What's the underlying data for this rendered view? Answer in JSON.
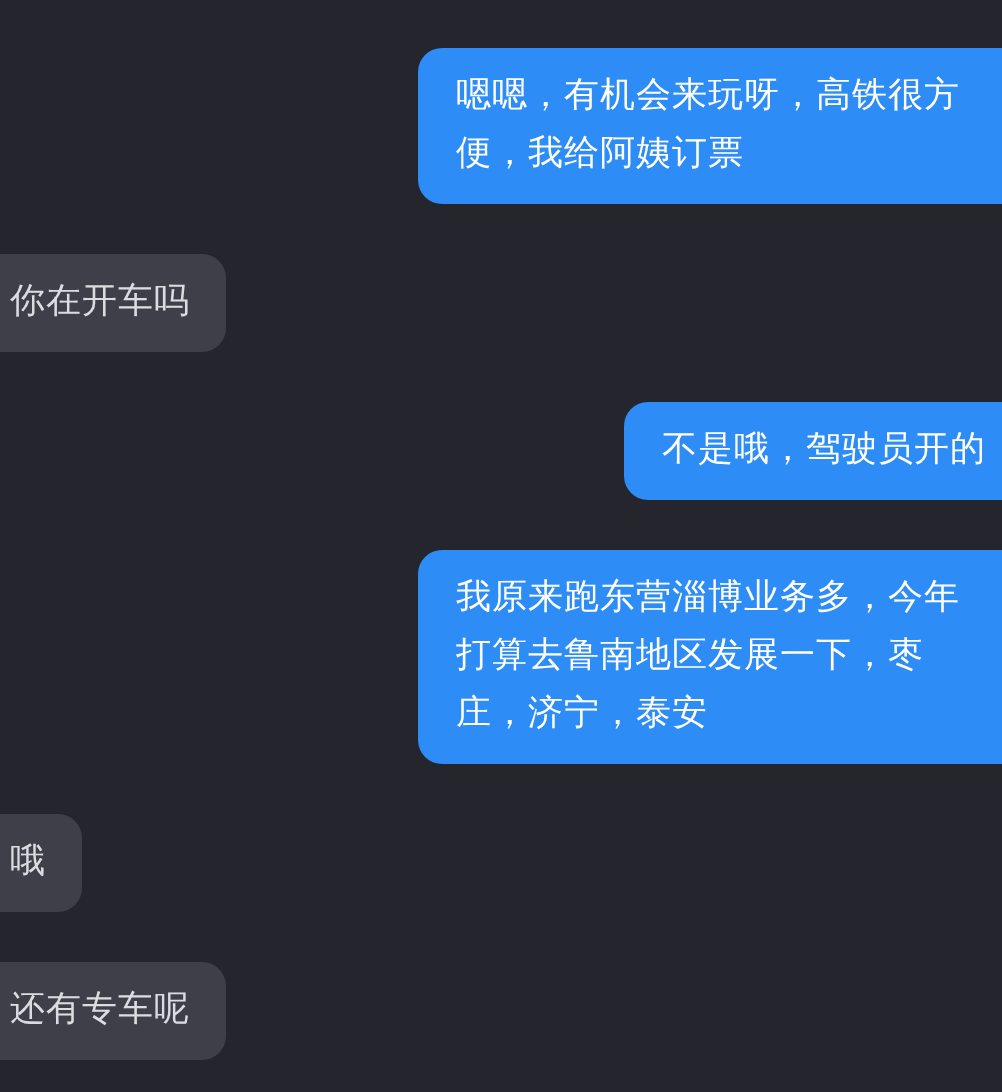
{
  "messages": [
    {
      "kind": "outgoing",
      "text": "嗯嗯，有机会来玩呀，高铁很方便，我给阿姨订票"
    },
    {
      "kind": "incoming",
      "text": "你在开车吗"
    },
    {
      "kind": "outgoing",
      "text": "不是哦，驾驶员开的"
    },
    {
      "kind": "outgoing",
      "text": "我原来跑东营淄博业务多，今年打算去鲁南地区发展一下，枣庄，济宁，泰安"
    },
    {
      "kind": "incoming",
      "text": "哦"
    },
    {
      "kind": "incoming",
      "text": "还有专车呢"
    }
  ]
}
